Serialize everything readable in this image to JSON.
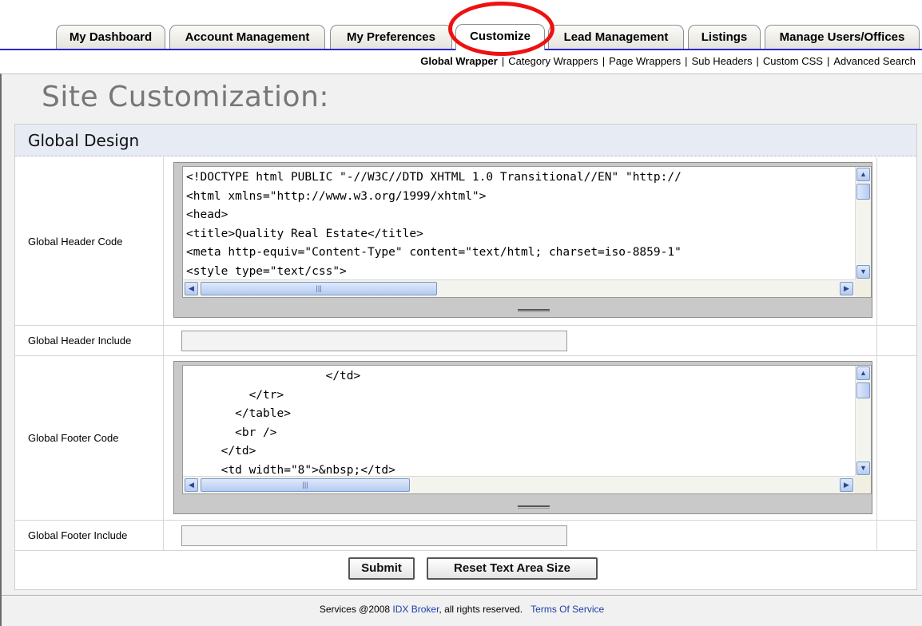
{
  "tabs": [
    {
      "label": "My Dashboard",
      "active": false
    },
    {
      "label": "Account Management",
      "active": false
    },
    {
      "label": "My Preferences",
      "active": false
    },
    {
      "label": "Customize",
      "active": true
    },
    {
      "label": "Lead Management",
      "active": false
    },
    {
      "label": "Listings",
      "active": false
    },
    {
      "label": "Manage Users/Offices",
      "active": false
    }
  ],
  "subnav": {
    "items": [
      "Global Wrapper",
      "Category Wrappers",
      "Page Wrappers",
      "Sub Headers",
      "Custom CSS",
      "Advanced Search"
    ],
    "current": "Global Wrapper",
    "separator": "|"
  },
  "page": {
    "title": "Site Customization:"
  },
  "section": {
    "title": "Global Design"
  },
  "fields": {
    "header_code": {
      "label": "Global Header Code",
      "lines": [
        "<!DOCTYPE html PUBLIC \"-//W3C//DTD XHTML 1.0 Transitional//EN\" \"http://",
        "<html xmlns=\"http://www.w3.org/1999/xhtml\">",
        "<head>",
        "<title>Quality Real Estate</title>",
        "<meta http-equiv=\"Content-Type\" content=\"text/html; charset=iso-8859-1\"",
        "<style type=\"text/css\">"
      ]
    },
    "header_include": {
      "label": "Global Header Include",
      "value": ""
    },
    "footer_code": {
      "label": "Global Footer Code",
      "lines": [
        "                    </td>",
        "         </tr>",
        "       </table>",
        "       <br />",
        "     </td>",
        "     <td width=\"8\">&nbsp;</td>"
      ]
    },
    "footer_include": {
      "label": "Global Footer Include",
      "value": ""
    }
  },
  "buttons": {
    "submit": "Submit",
    "reset": "Reset Text Area Size"
  },
  "footer": {
    "prefix": "Services @2008",
    "brand_link": "IDX Broker",
    "suffix": ", all rights reserved.",
    "terms_link": "Terms Of Service"
  },
  "colors": {
    "link": "#1c3ea8",
    "annotation": "#ee1111",
    "section_header_bg": "#e6ebf4",
    "tab_underline": "#2a2ac8"
  },
  "icons": [
    "scroll-up-arrow-icon",
    "scroll-down-arrow-icon",
    "scroll-left-arrow-icon",
    "scroll-right-arrow-icon",
    "resize-grip-icon"
  ]
}
